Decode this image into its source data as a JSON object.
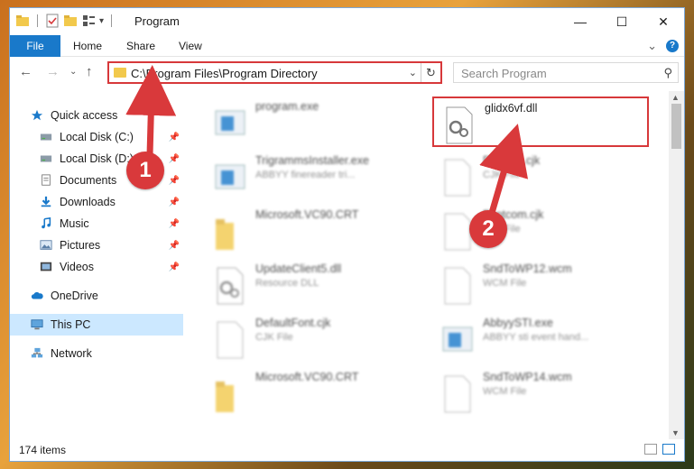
{
  "window": {
    "title": "Program",
    "controls": {
      "minimize": "—",
      "maximize": "☐",
      "close": "✕"
    }
  },
  "ribbon": {
    "tabs": [
      "File",
      "Home",
      "Share",
      "View"
    ],
    "expand": "⌄",
    "help": "?"
  },
  "navbar": {
    "address": "C:\\Program Files\\Program Directory",
    "search_placeholder": "Search Program"
  },
  "sidebar": {
    "items": [
      {
        "label": "Quick access",
        "icon": "star-icon",
        "pinned": false
      },
      {
        "label": "Local Disk (C:)",
        "icon": "drive-icon",
        "pinned": true
      },
      {
        "label": "Local Disk (D:)",
        "icon": "drive-icon",
        "pinned": true
      },
      {
        "label": "Documents",
        "icon": "documents-icon",
        "pinned": true
      },
      {
        "label": "Downloads",
        "icon": "download-icon",
        "pinned": true
      },
      {
        "label": "Music",
        "icon": "music-icon",
        "pinned": true
      },
      {
        "label": "Pictures",
        "icon": "pictures-icon",
        "pinned": true
      },
      {
        "label": "Videos",
        "icon": "videos-icon",
        "pinned": true
      },
      {
        "label": "OneDrive",
        "icon": "cloud-icon",
        "pinned": false
      },
      {
        "label": "This PC",
        "icon": "pc-icon",
        "pinned": false,
        "selected": true
      },
      {
        "label": "Network",
        "icon": "network-icon",
        "pinned": false
      }
    ]
  },
  "files": {
    "left": [
      {
        "name": "program.exe",
        "sub": "",
        "kind": "exe"
      },
      {
        "name": "TrigrammsInstaller.exe",
        "sub": "ABBYY finereader tri...",
        "kind": "exe"
      },
      {
        "name": "Microsoft.VC90.CRT",
        "sub": "",
        "kind": "folder"
      },
      {
        "name": "UpdateClient5.dll",
        "sub": "Resource DLL",
        "kind": "dll"
      },
      {
        "name": "DefaultFont.cjk",
        "sub": "CJK File",
        "kind": "doc"
      },
      {
        "name": "Microsoft.VC90.CRT",
        "sub": "",
        "kind": "folder"
      }
    ],
    "right": [
      {
        "name": "glidx6vf.dll",
        "sub": "",
        "kind": "dll",
        "highlight": true
      },
      {
        "name": "Fasttext.cjk",
        "sub": "CJK File",
        "kind": "doc"
      },
      {
        "name": "Fontcom.cjk",
        "sub": "CJK File",
        "kind": "doc"
      },
      {
        "name": "SndToWP12.wcm",
        "sub": "WCM File",
        "kind": "doc"
      },
      {
        "name": "AbbyySTI.exe",
        "sub": "ABBYY sti event hand...",
        "kind": "exe"
      },
      {
        "name": "SndToWP14.wcm",
        "sub": "WCM File",
        "kind": "doc"
      }
    ]
  },
  "status": {
    "count": "174 items"
  },
  "annotations": {
    "step1": "1",
    "step2": "2"
  },
  "colors": {
    "accent": "#1979ca",
    "highlight": "#d7383a",
    "selected": "#cce8ff"
  }
}
